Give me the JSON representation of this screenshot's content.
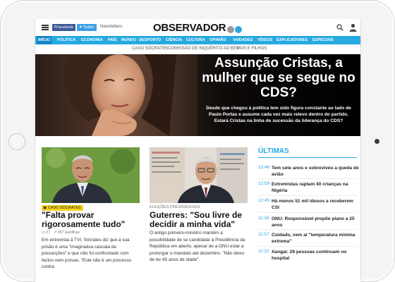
{
  "header": {
    "facebook_label": "Facebook",
    "twitter_label": "Twitter",
    "newsletters_label": "Newsletters",
    "logo_text": "OBSERVADOR"
  },
  "nav": {
    "items": [
      "INÍCIO",
      "POLÍTICA",
      "ECONOMIA",
      "PAÍS",
      "MUNDO",
      "DESPORTO",
      "CIÊNCIA",
      "CULTURA",
      "OPINIÃO",
      "VAIDADES",
      "VÍDEOS",
      "EXPLICADORES",
      "ESPECIAIS"
    ],
    "active": "INÍCIO"
  },
  "subnav": {
    "items": [
      "CASO SÓCRATES",
      "COMISSÃO DE INQUÉRITO AO BES",
      "PAIS E FILHOS"
    ]
  },
  "hero": {
    "title": "Assunção Cristas, a mulher que se segue no CDS?",
    "description": "Desde que chegou à política tem sido figura constante ao lado de Paulo Portas e assume cada vez mais relevo dentro do partido. Estará Cristas na linha de sucessão da liderança do CDS?"
  },
  "articles": [
    {
      "tag": "CASO SÓCRATES",
      "title": "\"Falta provar rigorosamente tudo\"",
      "comments": "27",
      "shares": "957 partilhas",
      "text": "Em entrevista à TVI, Sócrates diz que a sua prisão é uma \"imaginativa cascata de presunções\" e que não foi confrontado com factos nem provas. \"Este não é um processo contra"
    },
    {
      "tag": "ELEIÇÕES PRESIDENCIAIS",
      "title": "Guterres: \"Sou livre de decidir a minha vida\"",
      "text": "O antigo primeiro-ministro mantém a possibilidade de se candidatar à Presidência da República em aberto, apesar de a ONU estar a prolongar o mandato até dezembro. \"Não deixo de ter 65 anos de idade\"."
    }
  ],
  "ultimas": {
    "title": "ÚLTIMAS",
    "items": [
      {
        "time": "13:46",
        "text": "Tem sete anos e sobreviveu a queda de avião"
      },
      {
        "time": "12:59",
        "text": "Extremistas raptam 40 crianças na Nigéria"
      },
      {
        "time": "12:45",
        "text": "Há menos 51 mil idosos a receberem CSI"
      },
      {
        "time": "11:16",
        "text": "ONU: Responsável propõe plano a 25 anos"
      },
      {
        "time": "11:57",
        "text": "Cuidado, vem aí \"temperatura mínima extrema\""
      },
      {
        "time": "11:32",
        "text": "Xangai: 29 pessoas continuam no hospital"
      }
    ]
  },
  "colors": {
    "brand_blue": "#27a9e1",
    "nav_active": "#1289c7",
    "tag_yellow": "#f5d41a"
  }
}
